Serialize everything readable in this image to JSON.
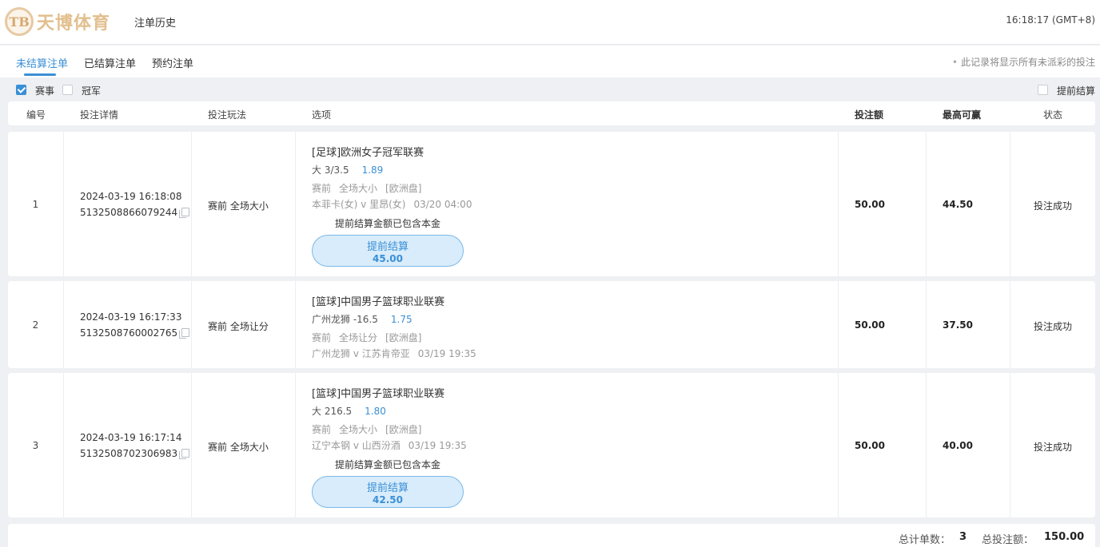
{
  "header": {
    "logo_mark": "TB",
    "logo_text": "天博体育",
    "title": "注单历史",
    "clock": "16:18:17 (GMT+8)"
  },
  "tabs": [
    {
      "label": "未结算注单",
      "active": true
    },
    {
      "label": "已结算注单",
      "active": false
    },
    {
      "label": "预约注单",
      "active": false
    }
  ],
  "tab_note": "此记录将显示所有未派彩的投注",
  "filters": {
    "event": {
      "label": "赛事",
      "checked": true
    },
    "champion": {
      "label": "冠军",
      "checked": false
    },
    "early_settle": {
      "label": "提前结算",
      "checked": false
    }
  },
  "columns": {
    "num": "编号",
    "detail": "投注详情",
    "play": "投注玩法",
    "option": "选项",
    "stake": "投注额",
    "max_win": "最高可赢",
    "status": "状态"
  },
  "bets": [
    {
      "num": "1",
      "time": "2024-03-19 16:18:08",
      "id": "5132508866079244",
      "play": "赛前 全场大小",
      "league": "[足球]欧洲女子冠军联赛",
      "pick": "大 3/3.5",
      "odds": "1.89",
      "meta1": "赛前",
      "meta2": "全场大小",
      "meta3": "[欧洲盘]",
      "match": "本菲卡(女) v 里昂(女)",
      "match_time": "03/20 04:00",
      "note": "提前结算金额已包含本金",
      "settle_label": "提前结算",
      "settle_amount": "45.00",
      "stake": "50.00",
      "max_win": "44.50",
      "status": "投注成功"
    },
    {
      "num": "2",
      "time": "2024-03-19 16:17:33",
      "id": "5132508760002765",
      "play": "赛前 全场让分",
      "league": "[篮球]中国男子篮球职业联赛",
      "pick": "广州龙狮 -16.5",
      "odds": "1.75",
      "meta1": "赛前",
      "meta2": "全场让分",
      "meta3": "[欧洲盘]",
      "match": "广州龙狮 v 江苏肯帝亚",
      "match_time": "03/19 19:35",
      "stake": "50.00",
      "max_win": "37.50",
      "status": "投注成功"
    },
    {
      "num": "3",
      "time": "2024-03-19 16:17:14",
      "id": "5132508702306983",
      "play": "赛前 全场大小",
      "league": "[篮球]中国男子篮球职业联赛",
      "pick": "大 216.5",
      "odds": "1.80",
      "meta1": "赛前",
      "meta2": "全场大小",
      "meta3": "[欧洲盘]",
      "match": "辽宁本钢 v 山西汾酒",
      "match_time": "03/19 19:35",
      "note": "提前结算金额已包含本金",
      "settle_label": "提前结算",
      "settle_amount": "42.50",
      "stake": "50.00",
      "max_win": "40.00",
      "status": "投注成功"
    }
  ],
  "footer": {
    "count_label": "总计单数：",
    "count": "3",
    "total_label": "总投注额：",
    "total": "150.00"
  },
  "colors": {
    "accent": "#3a8fd6",
    "settle_bg": "#d8ecfb",
    "logo_gold": "#e2bf8e",
    "page_bg": "#eef0f3"
  }
}
